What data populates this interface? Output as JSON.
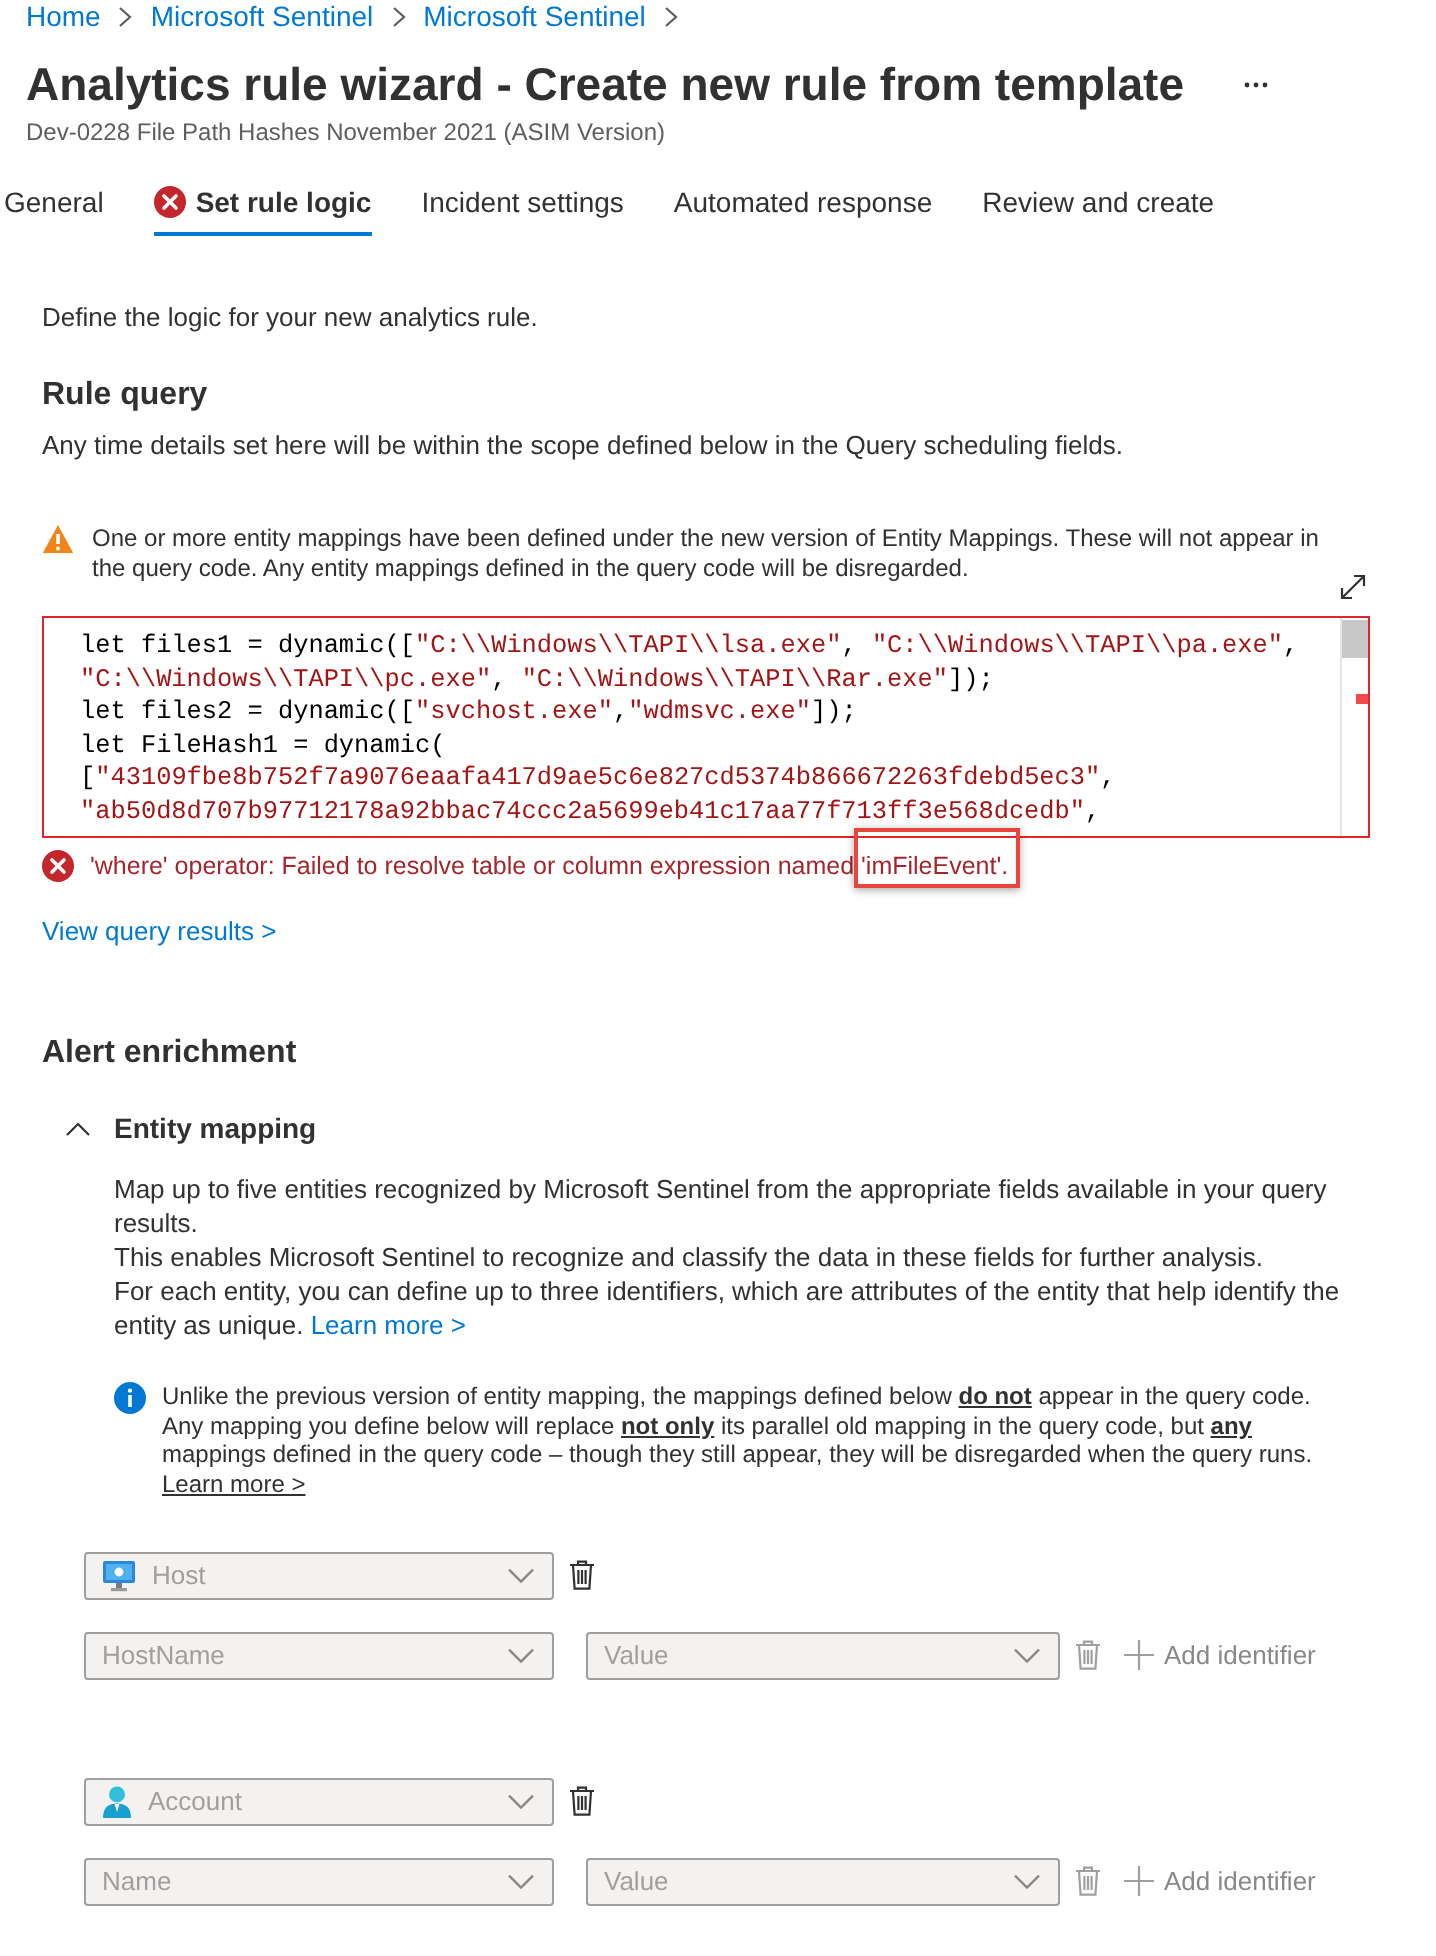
{
  "breadcrumb": [
    {
      "label": "Home"
    },
    {
      "label": "Microsoft Sentinel"
    },
    {
      "label": "Microsoft Sentinel"
    }
  ],
  "header": {
    "title": "Analytics rule wizard - Create new rule from template",
    "subtitle": "Dev-0228 File Path Hashes November 2021 (ASIM Version)"
  },
  "tabs": [
    {
      "label": "General",
      "selected": false,
      "error": false
    },
    {
      "label": "Set rule logic",
      "selected": true,
      "error": true
    },
    {
      "label": "Incident settings",
      "selected": false,
      "error": false
    },
    {
      "label": "Automated response",
      "selected": false,
      "error": false
    },
    {
      "label": "Review and create",
      "selected": false,
      "error": false
    }
  ],
  "intro": "Define the logic for your new analytics rule.",
  "rule_query": {
    "heading": "Rule query",
    "description": "Any time details set here will be within the scope defined below in the Query scheduling fields.",
    "warning": "One or more entity mappings have been defined under the new version of Entity Mappings. These will not appear in the query code. Any entity mappings defined in the query code will be disregarded.",
    "code_lines": [
      [
        {
          "kind": "plain",
          "text": "let files1 = dynamic(["
        },
        {
          "kind": "string",
          "text": "\"C:\\\\Windows\\\\TAPI\\\\lsa.exe\""
        },
        {
          "kind": "plain",
          "text": ", "
        },
        {
          "kind": "string",
          "text": "\"C:\\\\Windows\\\\TAPI\\\\pa.exe\""
        },
        {
          "kind": "plain",
          "text": ","
        }
      ],
      [
        {
          "kind": "string",
          "text": "\"C:\\\\Windows\\\\TAPI\\\\pc.exe\""
        },
        {
          "kind": "plain",
          "text": ", "
        },
        {
          "kind": "string",
          "text": "\"C:\\\\Windows\\\\TAPI\\\\Rar.exe\""
        },
        {
          "kind": "plain",
          "text": "]);"
        }
      ],
      [
        {
          "kind": "plain",
          "text": "let files2 = dynamic(["
        },
        {
          "kind": "string",
          "text": "\"svchost.exe\""
        },
        {
          "kind": "plain",
          "text": ","
        },
        {
          "kind": "string",
          "text": "\"wdmsvc.exe\""
        },
        {
          "kind": "plain",
          "text": "]);"
        }
      ],
      [
        {
          "kind": "plain",
          "text": "let FileHash1 = dynamic("
        }
      ],
      [
        {
          "kind": "plain",
          "text": "["
        },
        {
          "kind": "string",
          "text": "\"43109fbe8b752f7a9076eaafa417d9ae5c6e827cd5374b866672263fdebd5ec3\""
        },
        {
          "kind": "plain",
          "text": ","
        }
      ],
      [
        {
          "kind": "string",
          "text": "\"ab50d8d707b97712178a92bbac74ccc2a5699eb41c17aa77f713ff3e568dcedb\""
        },
        {
          "kind": "plain",
          "text": ","
        }
      ]
    ],
    "error": {
      "message": "'where' operator: Failed to resolve table or column expression named 'imFileEvent'.",
      "highlighted": true
    },
    "results_link": "View query results >"
  },
  "alert_enrichment": {
    "heading": "Alert enrichment",
    "entity_mapping": {
      "title": "Entity mapping",
      "expanded": true,
      "description": [
        "Map up to five entities recognized by Microsoft Sentinel from the appropriate fields available in your query results.",
        "This enables Microsoft Sentinel to recognize and classify the data in these fields for further analysis.",
        "For each entity, you can define up to three identifiers, which are attributes of the entity that help identify the entity as unique."
      ],
      "learn_more": "Learn more >",
      "info": {
        "text": "Unlike the previous version of entity mapping, the mappings defined below **do not** appear in the query code. Any mapping you define below will replace **not only** its parallel old mapping in the query code, but **any** mappings defined in the query code – though they still appear, they will be disregarded when the query runs.",
        "link": "Learn more >"
      },
      "entities": [
        {
          "kind": "host",
          "type": "Host",
          "disabled": true,
          "identifiers": [
            {
              "identifier": "HostName",
              "placeholder": "Value",
              "add_label": "Add identifier"
            }
          ]
        },
        {
          "kind": "account",
          "type": "Account",
          "disabled": true,
          "identifiers": [
            {
              "identifier": "Name",
              "placeholder": "Value",
              "add_label": "Add identifier"
            }
          ]
        }
      ]
    }
  }
}
